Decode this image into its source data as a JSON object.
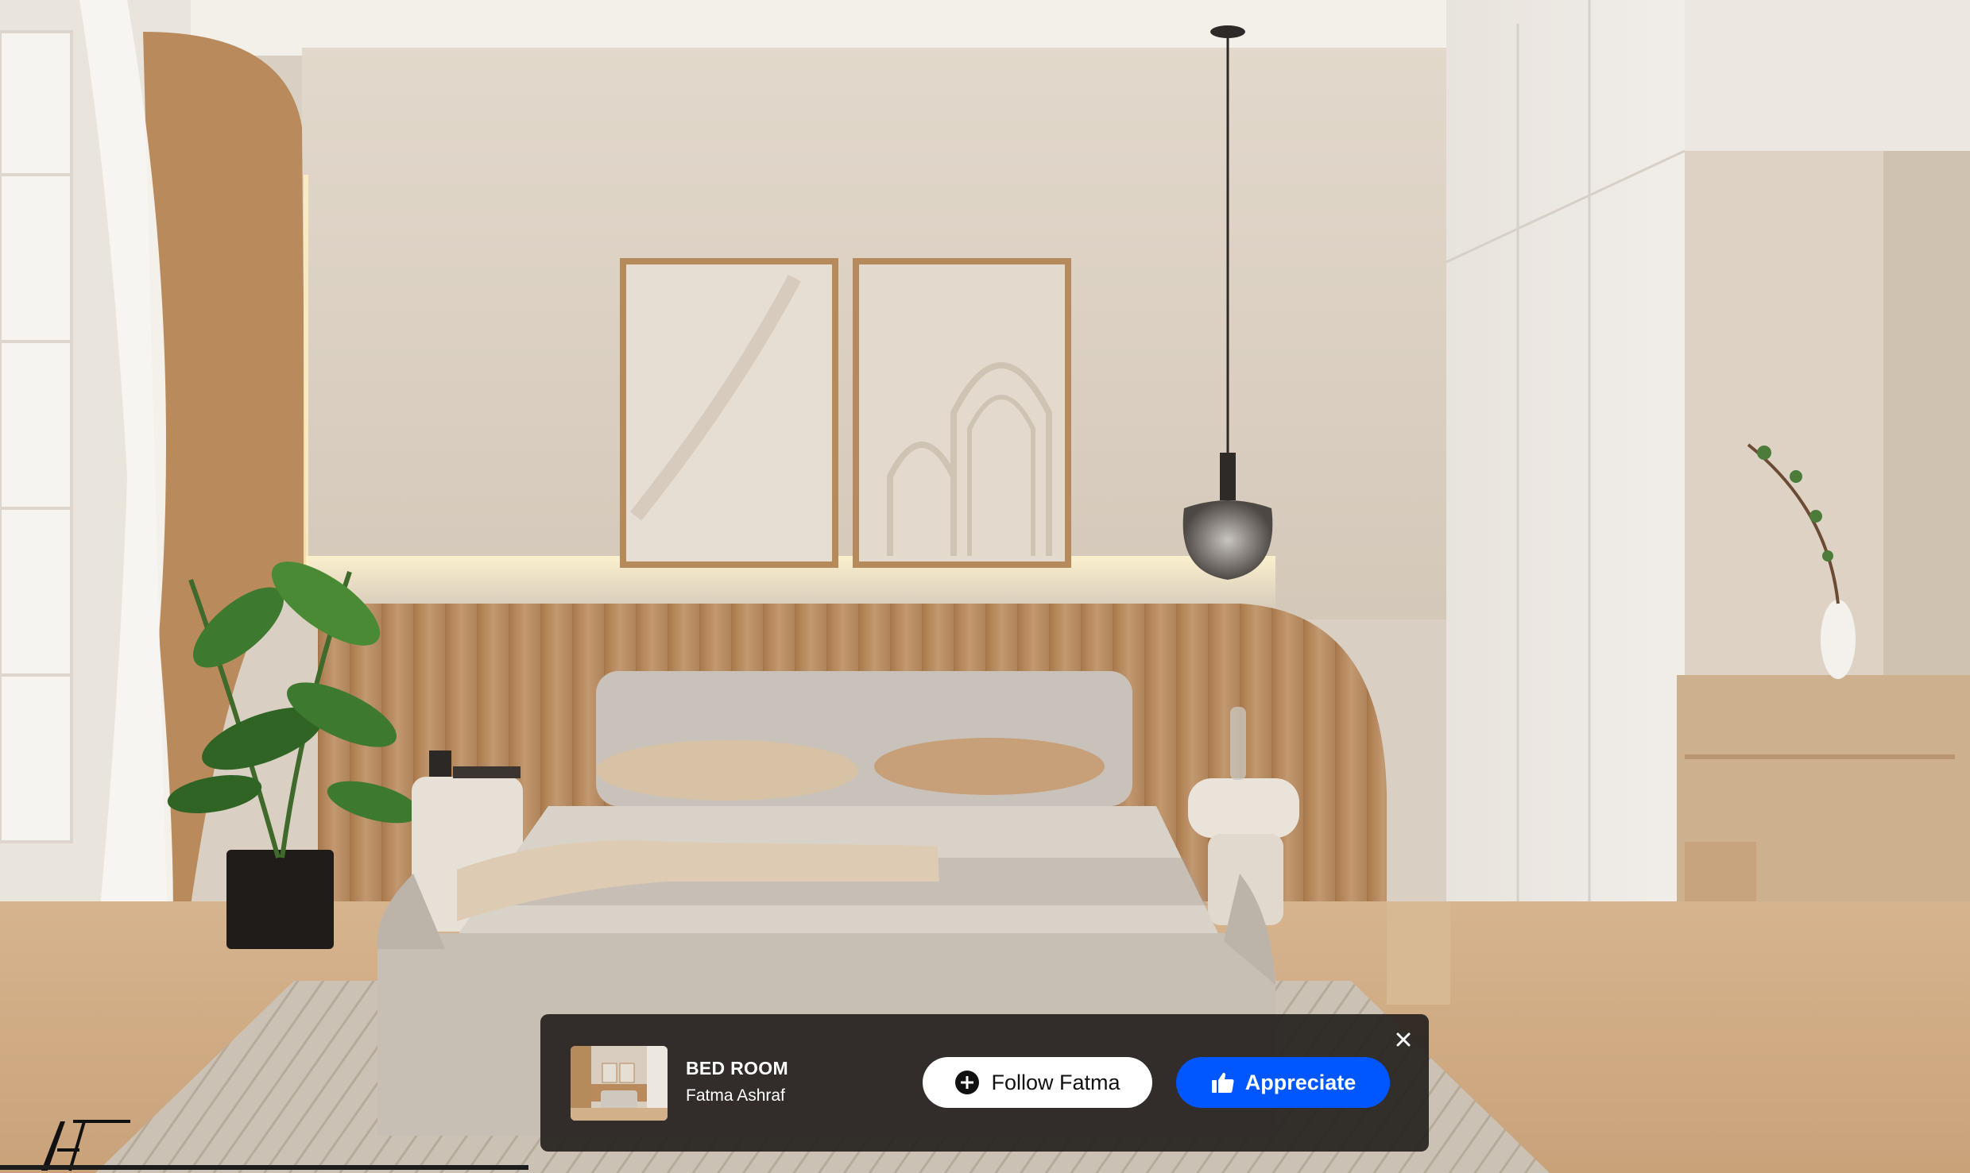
{
  "project_bar": {
    "title": "BED ROOM",
    "author": "Fatma Ashraf",
    "follow_label": "Follow Fatma",
    "appreciate_label": "Appreciate",
    "close_icon": "close-icon",
    "follow_icon": "plus-circle-icon",
    "appreciate_icon": "thumbs-up-icon"
  },
  "colors": {
    "bar_background": "#282421",
    "follow_button": "#ffffff",
    "appreciate_button": "#0057ff",
    "wall": "#d9cfc2",
    "wood": "#b58b5c"
  }
}
